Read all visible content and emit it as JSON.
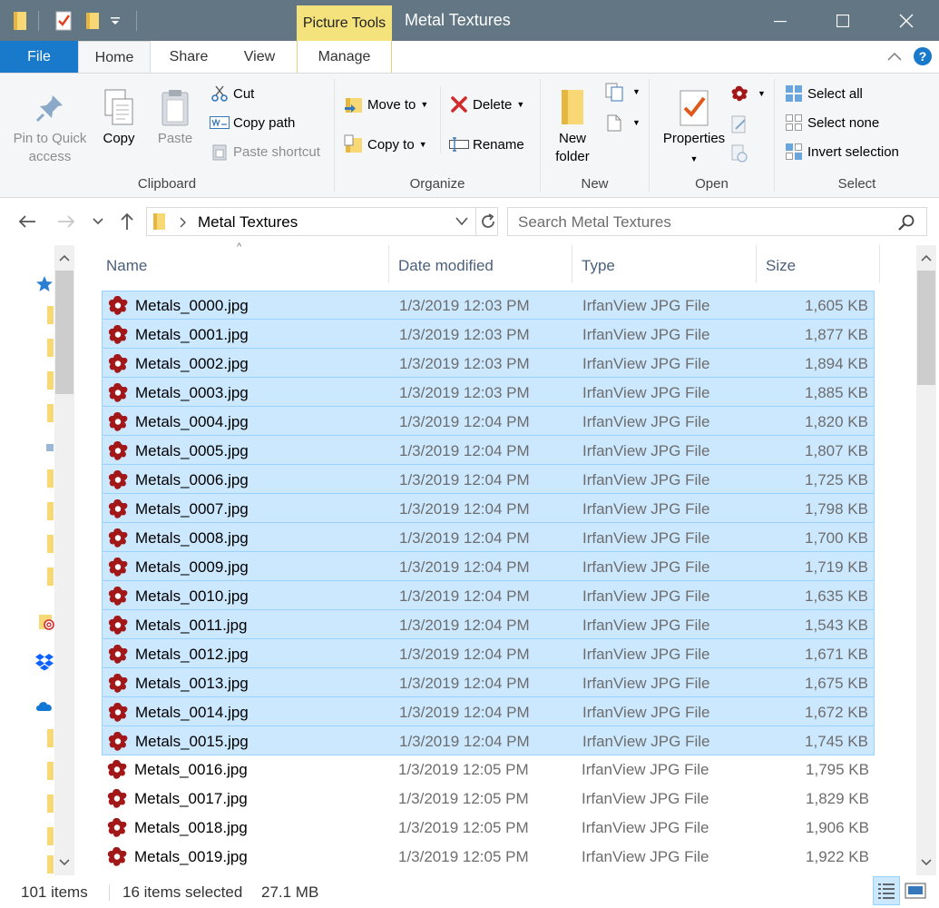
{
  "window": {
    "title": "Metal Textures",
    "context_tab": "Picture Tools"
  },
  "tabs": {
    "file": "File",
    "home": "Home",
    "share": "Share",
    "view": "View",
    "manage": "Manage"
  },
  "ribbon": {
    "clipboard": {
      "label": "Clipboard",
      "pin_line1": "Pin to Quick",
      "pin_line2": "access",
      "copy": "Copy",
      "paste": "Paste",
      "cut": "Cut",
      "copy_path": "Copy path",
      "paste_shortcut": "Paste shortcut"
    },
    "organize": {
      "label": "Organize",
      "move_to": "Move to",
      "copy_to": "Copy to",
      "delete": "Delete",
      "rename": "Rename"
    },
    "new": {
      "label": "New",
      "new_folder_line1": "New",
      "new_folder_line2": "folder"
    },
    "open": {
      "label": "Open",
      "properties": "Properties"
    },
    "select": {
      "label": "Select",
      "select_all": "Select all",
      "select_none": "Select none",
      "invert": "Invert selection"
    }
  },
  "address": {
    "path": "Metal Textures",
    "search_placeholder": "Search Metal Textures"
  },
  "columns": {
    "name": "Name",
    "date": "Date modified",
    "type": "Type",
    "size": "Size"
  },
  "files": [
    {
      "name": "Metals_0000.jpg",
      "date": "1/3/2019 12:03 PM",
      "type": "IrfanView JPG File",
      "size": "1,605 KB",
      "selected": true
    },
    {
      "name": "Metals_0001.jpg",
      "date": "1/3/2019 12:03 PM",
      "type": "IrfanView JPG File",
      "size": "1,877 KB",
      "selected": true
    },
    {
      "name": "Metals_0002.jpg",
      "date": "1/3/2019 12:03 PM",
      "type": "IrfanView JPG File",
      "size": "1,894 KB",
      "selected": true
    },
    {
      "name": "Metals_0003.jpg",
      "date": "1/3/2019 12:03 PM",
      "type": "IrfanView JPG File",
      "size": "1,885 KB",
      "selected": true
    },
    {
      "name": "Metals_0004.jpg",
      "date": "1/3/2019 12:04 PM",
      "type": "IrfanView JPG File",
      "size": "1,820 KB",
      "selected": true
    },
    {
      "name": "Metals_0005.jpg",
      "date": "1/3/2019 12:04 PM",
      "type": "IrfanView JPG File",
      "size": "1,807 KB",
      "selected": true
    },
    {
      "name": "Metals_0006.jpg",
      "date": "1/3/2019 12:04 PM",
      "type": "IrfanView JPG File",
      "size": "1,725 KB",
      "selected": true
    },
    {
      "name": "Metals_0007.jpg",
      "date": "1/3/2019 12:04 PM",
      "type": "IrfanView JPG File",
      "size": "1,798 KB",
      "selected": true
    },
    {
      "name": "Metals_0008.jpg",
      "date": "1/3/2019 12:04 PM",
      "type": "IrfanView JPG File",
      "size": "1,700 KB",
      "selected": true
    },
    {
      "name": "Metals_0009.jpg",
      "date": "1/3/2019 12:04 PM",
      "type": "IrfanView JPG File",
      "size": "1,719 KB",
      "selected": true
    },
    {
      "name": "Metals_0010.jpg",
      "date": "1/3/2019 12:04 PM",
      "type": "IrfanView JPG File",
      "size": "1,635 KB",
      "selected": true
    },
    {
      "name": "Metals_0011.jpg",
      "date": "1/3/2019 12:04 PM",
      "type": "IrfanView JPG File",
      "size": "1,543 KB",
      "selected": true
    },
    {
      "name": "Metals_0012.jpg",
      "date": "1/3/2019 12:04 PM",
      "type": "IrfanView JPG File",
      "size": "1,671 KB",
      "selected": true
    },
    {
      "name": "Metals_0013.jpg",
      "date": "1/3/2019 12:04 PM",
      "type": "IrfanView JPG File",
      "size": "1,675 KB",
      "selected": true
    },
    {
      "name": "Metals_0014.jpg",
      "date": "1/3/2019 12:04 PM",
      "type": "IrfanView JPG File",
      "size": "1,672 KB",
      "selected": true
    },
    {
      "name": "Metals_0015.jpg",
      "date": "1/3/2019 12:04 PM",
      "type": "IrfanView JPG File",
      "size": "1,745 KB",
      "selected": true
    },
    {
      "name": "Metals_0016.jpg",
      "date": "1/3/2019 12:05 PM",
      "type": "IrfanView JPG File",
      "size": "1,795 KB",
      "selected": false
    },
    {
      "name": "Metals_0017.jpg",
      "date": "1/3/2019 12:05 PM",
      "type": "IrfanView JPG File",
      "size": "1,829 KB",
      "selected": false
    },
    {
      "name": "Metals_0018.jpg",
      "date": "1/3/2019 12:05 PM",
      "type": "IrfanView JPG File",
      "size": "1,906 KB",
      "selected": false
    },
    {
      "name": "Metals_0019.jpg",
      "date": "1/3/2019 12:05 PM",
      "type": "IrfanView JPG File",
      "size": "1,922 KB",
      "selected": false
    }
  ],
  "status": {
    "items": "101 items",
    "selected": "16 items selected",
    "size": "27.1 MB"
  },
  "colors": {
    "titlebar": "#627684",
    "file_tab": "#1979ca",
    "context_tab": "#f4e27d",
    "selection": "#cce8ff",
    "selection_border": "#99d1ff"
  },
  "icons": {
    "file": "irfanview-file-icon",
    "folder": "folder-icon"
  }
}
